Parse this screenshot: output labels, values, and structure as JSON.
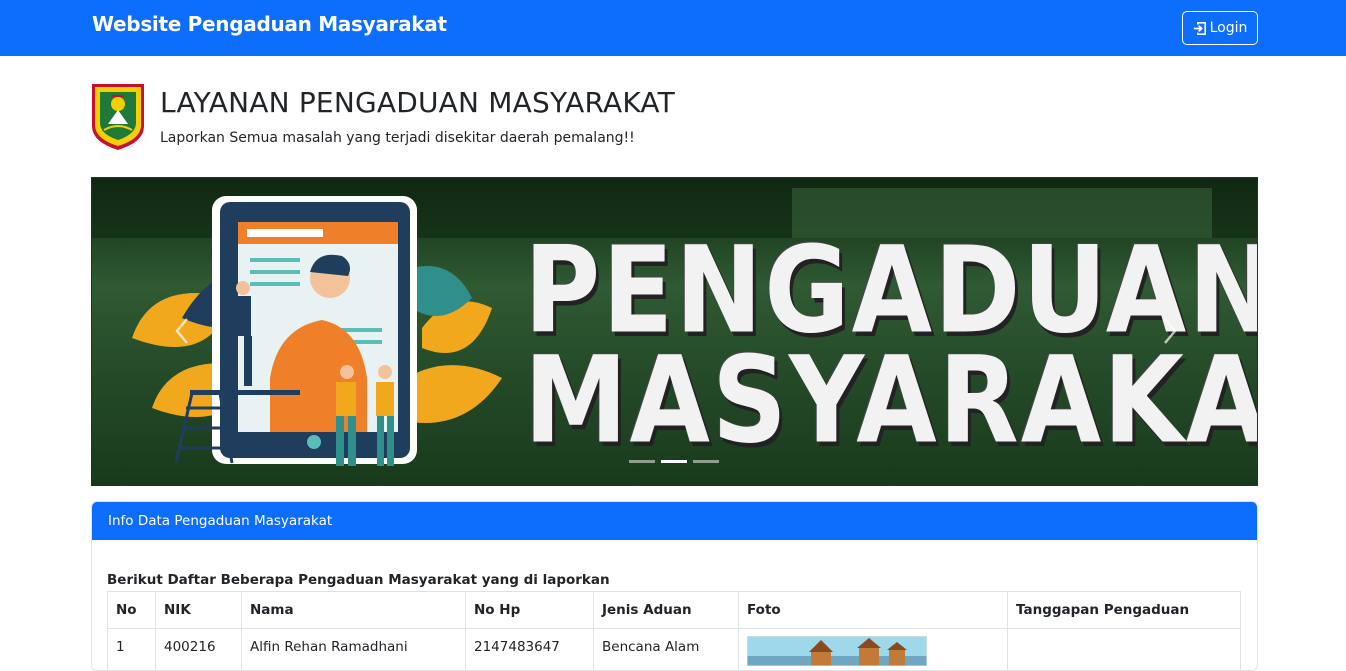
{
  "navbar": {
    "brand": "Website Pengaduan Masyarakat",
    "login_label": "Login",
    "login_icon": "sign-in-icon",
    "bg_color": "#0d6efd"
  },
  "hero": {
    "title": "LAYANAN PENGADUAN MASYARAKAT",
    "subtitle": "Laporkan Semua masalah yang terjadi disekitar daerah pemalang!!"
  },
  "carousel": {
    "line1": "PENGADUAN",
    "line2": "MASYARAKAT",
    "active_slide": 2,
    "slide_count": 3
  },
  "card": {
    "header": "Info Data Pengaduan Masyarakat",
    "caption": "Berikut Daftar Beberapa Pengaduan Masyarakat yang di laporkan",
    "columns": [
      "No",
      "NIK",
      "Nama",
      "No Hp",
      "Jenis Aduan",
      "Foto",
      "Tanggapan Pengaduan"
    ],
    "rows": [
      {
        "no": "1",
        "nik": "400216",
        "nama": "Alfin Rehan Ramadhani",
        "no_hp": "2147483647",
        "jenis": "Bencana Alam",
        "tanggapan": ""
      }
    ]
  }
}
